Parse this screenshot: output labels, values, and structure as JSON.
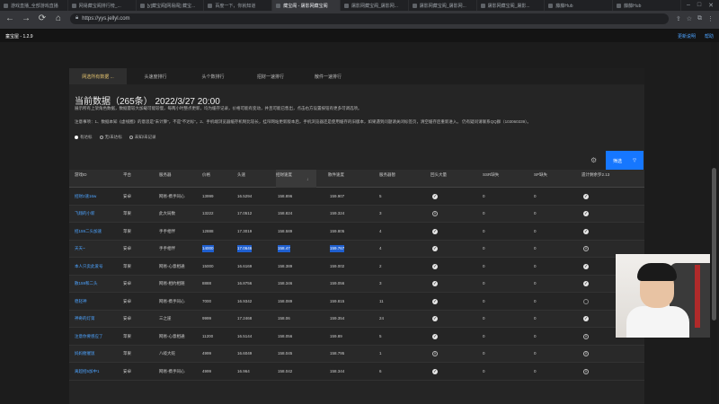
{
  "browser": {
    "tabs": [
      {
        "label": "游戏直播_全部游戏直播"
      },
      {
        "label": "网易藏宝阁排行榜_...",
        "active": false
      },
      {
        "label": "[y]藏宝阁[网易阁] 藏宝..."
      },
      {
        "label": "百度一下，你就知道"
      },
      {
        "label": "藏宝阁 - 屠影网藏宝阁",
        "active": true
      },
      {
        "label": "屠影网藏宝阁_屠影网..."
      },
      {
        "label": "屠影网藏宝阁_屠影网..."
      },
      {
        "label": "屠影网藏宝阁_屠影..."
      },
      {
        "label": "藤藤Hub"
      },
      {
        "label": "藤藤Hub"
      }
    ],
    "url": "https://yys.jellyl.com",
    "nav": {
      "back": "←",
      "forward": "→",
      "reload": "⟳",
      "home": "⌂"
    }
  },
  "site": {
    "name": "童宝屋 - 1.2.9",
    "links": [
      "更新说明",
      "帮助"
    ]
  },
  "subtabs": [
    "网选所有数据 ...",
    "头速度排行",
    "头个数排行",
    "招财一速排行",
    "散件一速排行"
  ],
  "title": "当前数据（265条）   2022/3/27 20:00",
  "notice": "展示所有上架角色数据，数据量较大加载可能较慢，每两小时整点更新，均为缓存记录，价格可能有变动，并且可能已售出，点击右方设置按钮有更多可调选项。",
  "notes": "注意事项：1、数据本知《虚线圈》的意思是\"未计算\"，不是\"不达标\"。2、手机端浏览器缓存机制比较长，挂帘网站更新版本后，手机浏览器还是使用缓存的旧版本，如果遇到问题请关闭标签页，清空缓存后重新进入。 仍有疑问请联系QQ群（103060339）。",
  "radios": [
    {
      "label": "有达标",
      "checked": true
    },
    {
      "label": "无/未达标",
      "checked": false
    },
    {
      "label": "未知/未记录",
      "checked": false
    }
  ],
  "filter_button": {
    "label": "筛选",
    "icon": "▽"
  },
  "table": {
    "headers": [
      "游戏ID",
      "平台",
      "服务器",
      "价格",
      "头速",
      "招财速度",
      "散件速度",
      "服务器暂",
      "回头大量",
      "SSR缺失",
      "SP缺失",
      "遗计剩余罗2.13"
    ],
    "rows": [
      {
        "id": "招财2速16w",
        "platform": "安卓",
        "server": "网易-携手同心",
        "price": "13999",
        "head": "16.5294",
        "zhaocai": "158.896",
        "sanjian": "159.907",
        "count": "5",
        "a": "check",
        "ssr": "0",
        "sp": "0",
        "last": "check"
      },
      {
        "id": "飞翔的小新",
        "platform": "苹果",
        "server": "此大局数",
        "price": "13222",
        "head": "17.0512",
        "zhaocai": "158.824",
        "sanjian": "159.324",
        "count": "3",
        "a": "x",
        "ssr": "0",
        "sp": "0",
        "last": "check"
      },
      {
        "id": "招159二头加速",
        "platform": "苹果",
        "server": "手手相伴",
        "price": "12888",
        "head": "17.3019",
        "zhaocai": "158.589",
        "sanjian": "159.805",
        "count": "4",
        "a": "check",
        "ssr": "0",
        "sp": "0",
        "last": "check"
      },
      {
        "id": "天天~",
        "platform": "安卓",
        "server": "手手相伴",
        "price": "14000",
        "head": "17.0646",
        "zhaocai": "158.47",
        "sanjian": "159.767",
        "count": "4",
        "a": "check",
        "ssr": "0",
        "sp": "0",
        "last": "x",
        "highlight": true
      },
      {
        "id": "本人只卖此爱号",
        "platform": "苹果",
        "server": "网易-心意相通",
        "price": "15000",
        "head": "16.6169",
        "zhaocai": "158.389",
        "sanjian": "159.002",
        "count": "2",
        "a": "check",
        "ssr": "0",
        "sp": "0",
        "last": "check"
      },
      {
        "id": "散159和二头",
        "platform": "安卓",
        "server": "网易-相约相随",
        "price": "8888",
        "head": "16.8756",
        "zhaocai": "158.346",
        "sanjian": "159.056",
        "count": "3",
        "a": "check",
        "ssr": "0",
        "sp": "0",
        "last": "check"
      },
      {
        "id": "稳轻神",
        "platform": "安卓",
        "server": "网易-携手同心",
        "price": "7000",
        "head": "16.9342",
        "zhaocai": "158.089",
        "sanjian": "159.815",
        "count": "11",
        "a": "check",
        "ssr": "0",
        "sp": "0",
        "last": "o"
      },
      {
        "id": "神奇的灯第",
        "platform": "安卓",
        "server": "三之崖",
        "price": "9999",
        "head": "17.2468",
        "zhaocai": "158.06",
        "sanjian": "159.354",
        "count": "24",
        "a": "check",
        "ssr": "0",
        "sp": "0",
        "last": "check"
      },
      {
        "id": "注意你要感应了",
        "platform": "苹果",
        "server": "网易-心意相通",
        "price": "11200",
        "head": "16.5144",
        "zhaocai": "158.056",
        "sanjian": "159.89",
        "count": "5",
        "a": "check",
        "ssr": "0",
        "sp": "0",
        "last": "x"
      },
      {
        "id": "妈妈催催饭",
        "platform": "苹果",
        "server": "八岐大蛇",
        "price": "4999",
        "head": "16.6049",
        "zhaocai": "158.045",
        "sanjian": "158.795",
        "count": "1",
        "a": "x",
        "ssr": "0",
        "sp": "0",
        "last": "x"
      },
      {
        "id": "离超招5加中1",
        "platform": "安卓",
        "server": "网易-携手同心",
        "price": "4999",
        "head": "16.964",
        "zhaocai": "158.042",
        "sanjian": "158.344",
        "count": "6",
        "a": "check",
        "ssr": "0",
        "sp": "0",
        "last": "x"
      }
    ]
  }
}
